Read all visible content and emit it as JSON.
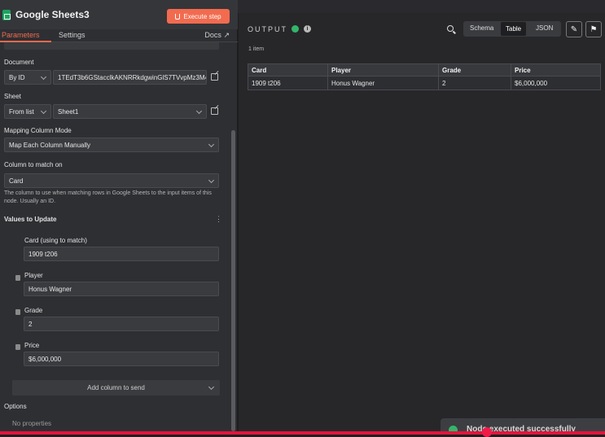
{
  "node": {
    "title": "Google Sheets3",
    "execute_label": "Execute step",
    "tabs": [
      "Parameters",
      "Settings"
    ],
    "docs_label": "Docs"
  },
  "params": {
    "document_label": "Document",
    "document_mode": "By ID",
    "document_id": "1TEdT3b6GStacclkAKNRRkdgwinGlS7TVvpMz3M4",
    "sheet_label": "Sheet",
    "sheet_mode": "From list",
    "sheet_value": "Sheet1",
    "mapping_label": "Mapping Column Mode",
    "mapping_value": "Map Each Column Manually",
    "match_label": "Column to match on",
    "match_value": "Card",
    "match_hint": "The column to use when matching rows in Google Sheets to the input items of this node. Usually an ID.",
    "values_label": "Values to Update",
    "fields": [
      {
        "label": "Card (using to match)",
        "value": "1909 t206"
      },
      {
        "label": "Player",
        "value": "Honus Wagner"
      },
      {
        "label": "Grade",
        "value": "2"
      },
      {
        "label": "Price",
        "value": "$6,000,000"
      }
    ],
    "add_column_label": "Add column to send",
    "options_label": "Options",
    "no_properties": "No properties"
  },
  "output": {
    "title": "OUTPUT",
    "view_tabs": [
      "Schema",
      "Table",
      "JSON"
    ],
    "active_view": "Table",
    "items_count": "1 item",
    "columns": [
      "Card",
      "Player",
      "Grade",
      "Price"
    ],
    "rows": [
      [
        "1909 t206",
        "Honus Wagner",
        "2",
        "$6,000,000"
      ]
    ]
  },
  "toast": {
    "text": "Node executed successfully"
  },
  "colors": {
    "accent": "#f26b4f",
    "success": "#32b66b",
    "sheets_green": "#1ea362"
  },
  "icons": [
    "google-sheets-icon",
    "flask-icon",
    "external-link-icon",
    "check-circle-icon",
    "info-icon",
    "search-icon",
    "pencil-icon",
    "pin-icon",
    "trash-icon",
    "more-vertical-icon"
  ]
}
